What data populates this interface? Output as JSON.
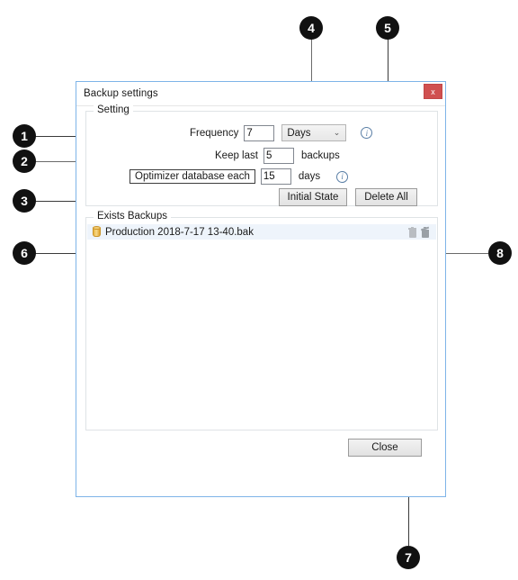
{
  "dialog": {
    "title": "Backup settings",
    "close_x_label": "x",
    "close_button_label": "Close"
  },
  "setting_group": {
    "legend": "Setting",
    "frequency": {
      "label": "Frequency",
      "value": "7",
      "unit_selected": "Days",
      "unit_options": [
        "Days"
      ],
      "chevron": "⌄",
      "info_icon_label": "i"
    },
    "keep_last": {
      "label": "Keep last",
      "value": "5",
      "suffix": "backups"
    },
    "optimizer": {
      "label": "Optimizer database each",
      "value": "15",
      "suffix": "days",
      "info_icon_label": "i"
    },
    "buttons": {
      "initial_state": "Initial State",
      "delete_all": "Delete All"
    }
  },
  "backups_group": {
    "legend": "Exists Backups",
    "rows": [
      {
        "name": "Production 2018-7-17 13-40.bak",
        "icon": "database-icon",
        "delete_icon": "trash-empty-icon",
        "delete_all_icon": "trash-full-icon"
      }
    ]
  },
  "callouts": [
    {
      "number": "1"
    },
    {
      "number": "2"
    },
    {
      "number": "3"
    },
    {
      "number": "4"
    },
    {
      "number": "5"
    },
    {
      "number": "6"
    },
    {
      "number": "7"
    },
    {
      "number": "8"
    }
  ],
  "colors": {
    "dialog_border": "#7eb4e8",
    "close_red": "#d05050",
    "selection_blue": "#eef4fb",
    "callout_black": "#111111",
    "info_blue": "#5a7fa6",
    "db_yellow": "#e8b33c"
  }
}
